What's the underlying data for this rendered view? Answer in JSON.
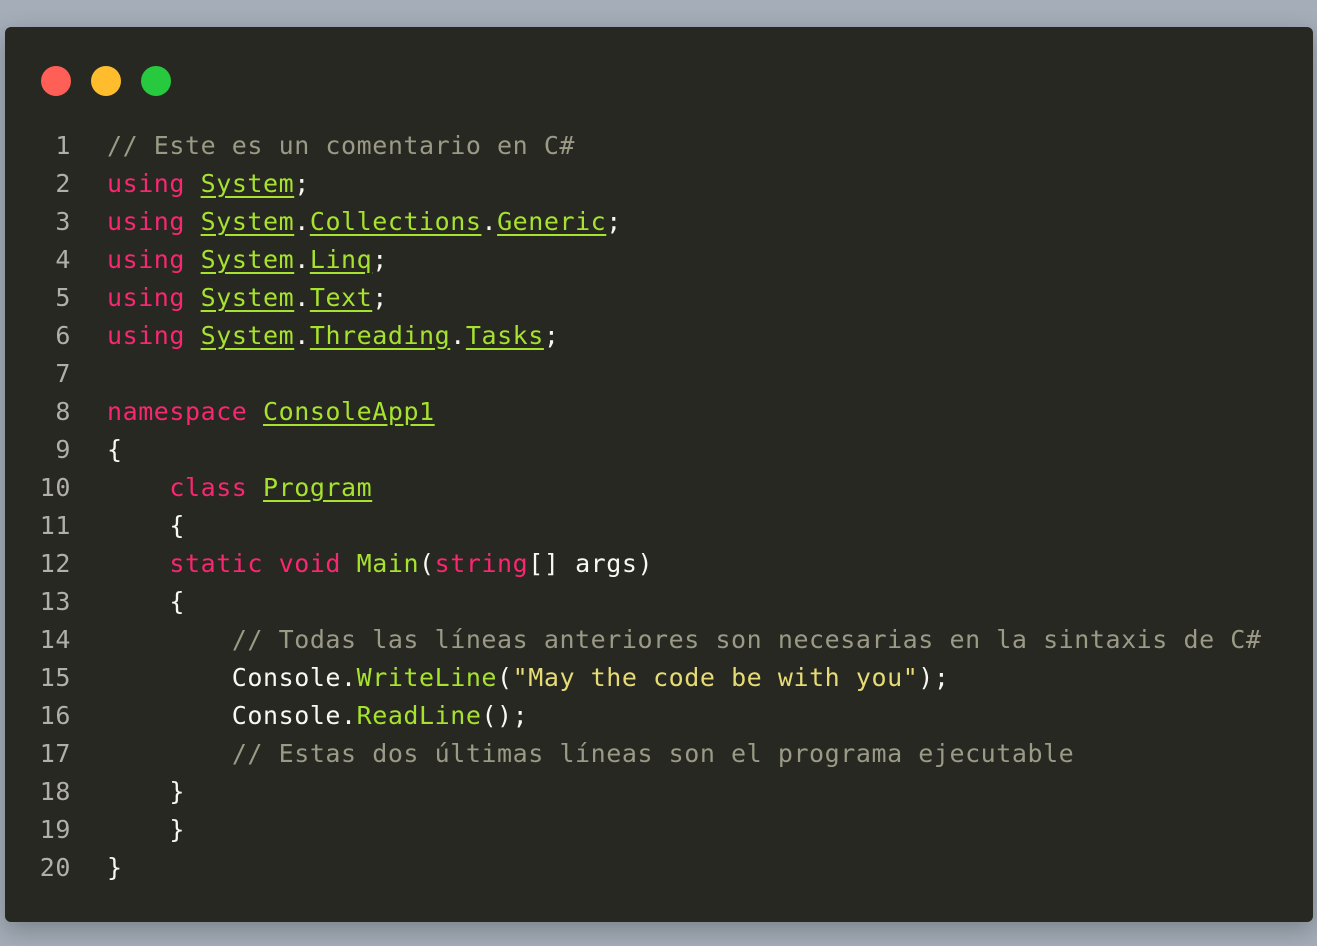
{
  "window": {
    "controls": [
      {
        "name": "close",
        "color": "#ff5f56"
      },
      {
        "name": "minimize",
        "color": "#ffbd2e"
      },
      {
        "name": "maximize",
        "color": "#27c93f"
      }
    ]
  },
  "colors": {
    "background": "#272822",
    "keyword": "#f92672",
    "type": "#a6e22e",
    "comment": "#9a9a86",
    "string": "#e6db74",
    "plain": "#f8f8f2",
    "line_number": "#b0b0a8"
  },
  "code": {
    "language": "C#",
    "lines": [
      {
        "number": "1",
        "tokens": [
          {
            "t": "comment",
            "v": "// Este es un comentario en C#"
          }
        ]
      },
      {
        "number": "2",
        "tokens": [
          {
            "t": "keyword",
            "v": "using"
          },
          {
            "t": "plain",
            "v": " "
          },
          {
            "t": "type",
            "v": "System"
          },
          {
            "t": "plain",
            "v": ";"
          }
        ]
      },
      {
        "number": "3",
        "tokens": [
          {
            "t": "keyword",
            "v": "using"
          },
          {
            "t": "plain",
            "v": " "
          },
          {
            "t": "type",
            "v": "System"
          },
          {
            "t": "plain",
            "v": "."
          },
          {
            "t": "type",
            "v": "Collections"
          },
          {
            "t": "plain",
            "v": "."
          },
          {
            "t": "type",
            "v": "Generic"
          },
          {
            "t": "plain",
            "v": ";"
          }
        ]
      },
      {
        "number": "4",
        "tokens": [
          {
            "t": "keyword",
            "v": "using"
          },
          {
            "t": "plain",
            "v": " "
          },
          {
            "t": "type",
            "v": "System"
          },
          {
            "t": "plain",
            "v": "."
          },
          {
            "t": "type",
            "v": "Linq"
          },
          {
            "t": "plain",
            "v": ";"
          }
        ]
      },
      {
        "number": "5",
        "tokens": [
          {
            "t": "keyword",
            "v": "using"
          },
          {
            "t": "plain",
            "v": " "
          },
          {
            "t": "type",
            "v": "System"
          },
          {
            "t": "plain",
            "v": "."
          },
          {
            "t": "type",
            "v": "Text"
          },
          {
            "t": "plain",
            "v": ";"
          }
        ]
      },
      {
        "number": "6",
        "tokens": [
          {
            "t": "keyword",
            "v": "using"
          },
          {
            "t": "plain",
            "v": " "
          },
          {
            "t": "type",
            "v": "System"
          },
          {
            "t": "plain",
            "v": "."
          },
          {
            "t": "type",
            "v": "Threading"
          },
          {
            "t": "plain",
            "v": "."
          },
          {
            "t": "type",
            "v": "Tasks"
          },
          {
            "t": "plain",
            "v": ";"
          }
        ]
      },
      {
        "number": "7",
        "tokens": []
      },
      {
        "number": "8",
        "tokens": [
          {
            "t": "keyword",
            "v": "namespace"
          },
          {
            "t": "plain",
            "v": " "
          },
          {
            "t": "type",
            "v": "ConsoleApp1"
          }
        ]
      },
      {
        "number": "9",
        "tokens": [
          {
            "t": "plain",
            "v": "{"
          }
        ]
      },
      {
        "number": "10",
        "tokens": [
          {
            "t": "plain",
            "v": "    "
          },
          {
            "t": "keyword",
            "v": "class"
          },
          {
            "t": "plain",
            "v": " "
          },
          {
            "t": "type",
            "v": "Program"
          }
        ]
      },
      {
        "number": "11",
        "tokens": [
          {
            "t": "plain",
            "v": "    {"
          }
        ]
      },
      {
        "number": "12",
        "tokens": [
          {
            "t": "plain",
            "v": "    "
          },
          {
            "t": "keyword",
            "v": "static"
          },
          {
            "t": "plain",
            "v": " "
          },
          {
            "t": "keyword",
            "v": "void"
          },
          {
            "t": "plain",
            "v": " "
          },
          {
            "t": "func",
            "v": "Main"
          },
          {
            "t": "plain",
            "v": "("
          },
          {
            "t": "keyword",
            "v": "string"
          },
          {
            "t": "plain",
            "v": "[] args)"
          }
        ]
      },
      {
        "number": "13",
        "tokens": [
          {
            "t": "plain",
            "v": "    {"
          }
        ]
      },
      {
        "number": "14",
        "tokens": [
          {
            "t": "plain",
            "v": "        "
          },
          {
            "t": "comment",
            "v": "// Todas las líneas anteriores son necesarias en la sintaxis de C#"
          }
        ]
      },
      {
        "number": "15",
        "tokens": [
          {
            "t": "plain",
            "v": "        Console."
          },
          {
            "t": "func",
            "v": "WriteLine"
          },
          {
            "t": "plain",
            "v": "("
          },
          {
            "t": "string",
            "v": "\"May the code be with you\""
          },
          {
            "t": "plain",
            "v": ");"
          }
        ]
      },
      {
        "number": "16",
        "tokens": [
          {
            "t": "plain",
            "v": "        Console."
          },
          {
            "t": "func",
            "v": "ReadLine"
          },
          {
            "t": "plain",
            "v": "();"
          }
        ]
      },
      {
        "number": "17",
        "tokens": [
          {
            "t": "plain",
            "v": "        "
          },
          {
            "t": "comment",
            "v": "// Estas dos últimas líneas son el programa ejecutable"
          }
        ]
      },
      {
        "number": "18",
        "tokens": [
          {
            "t": "plain",
            "v": "    }"
          }
        ]
      },
      {
        "number": "19",
        "tokens": [
          {
            "t": "plain",
            "v": "    }"
          }
        ]
      },
      {
        "number": "20",
        "tokens": [
          {
            "t": "plain",
            "v": "}"
          }
        ]
      }
    ]
  }
}
